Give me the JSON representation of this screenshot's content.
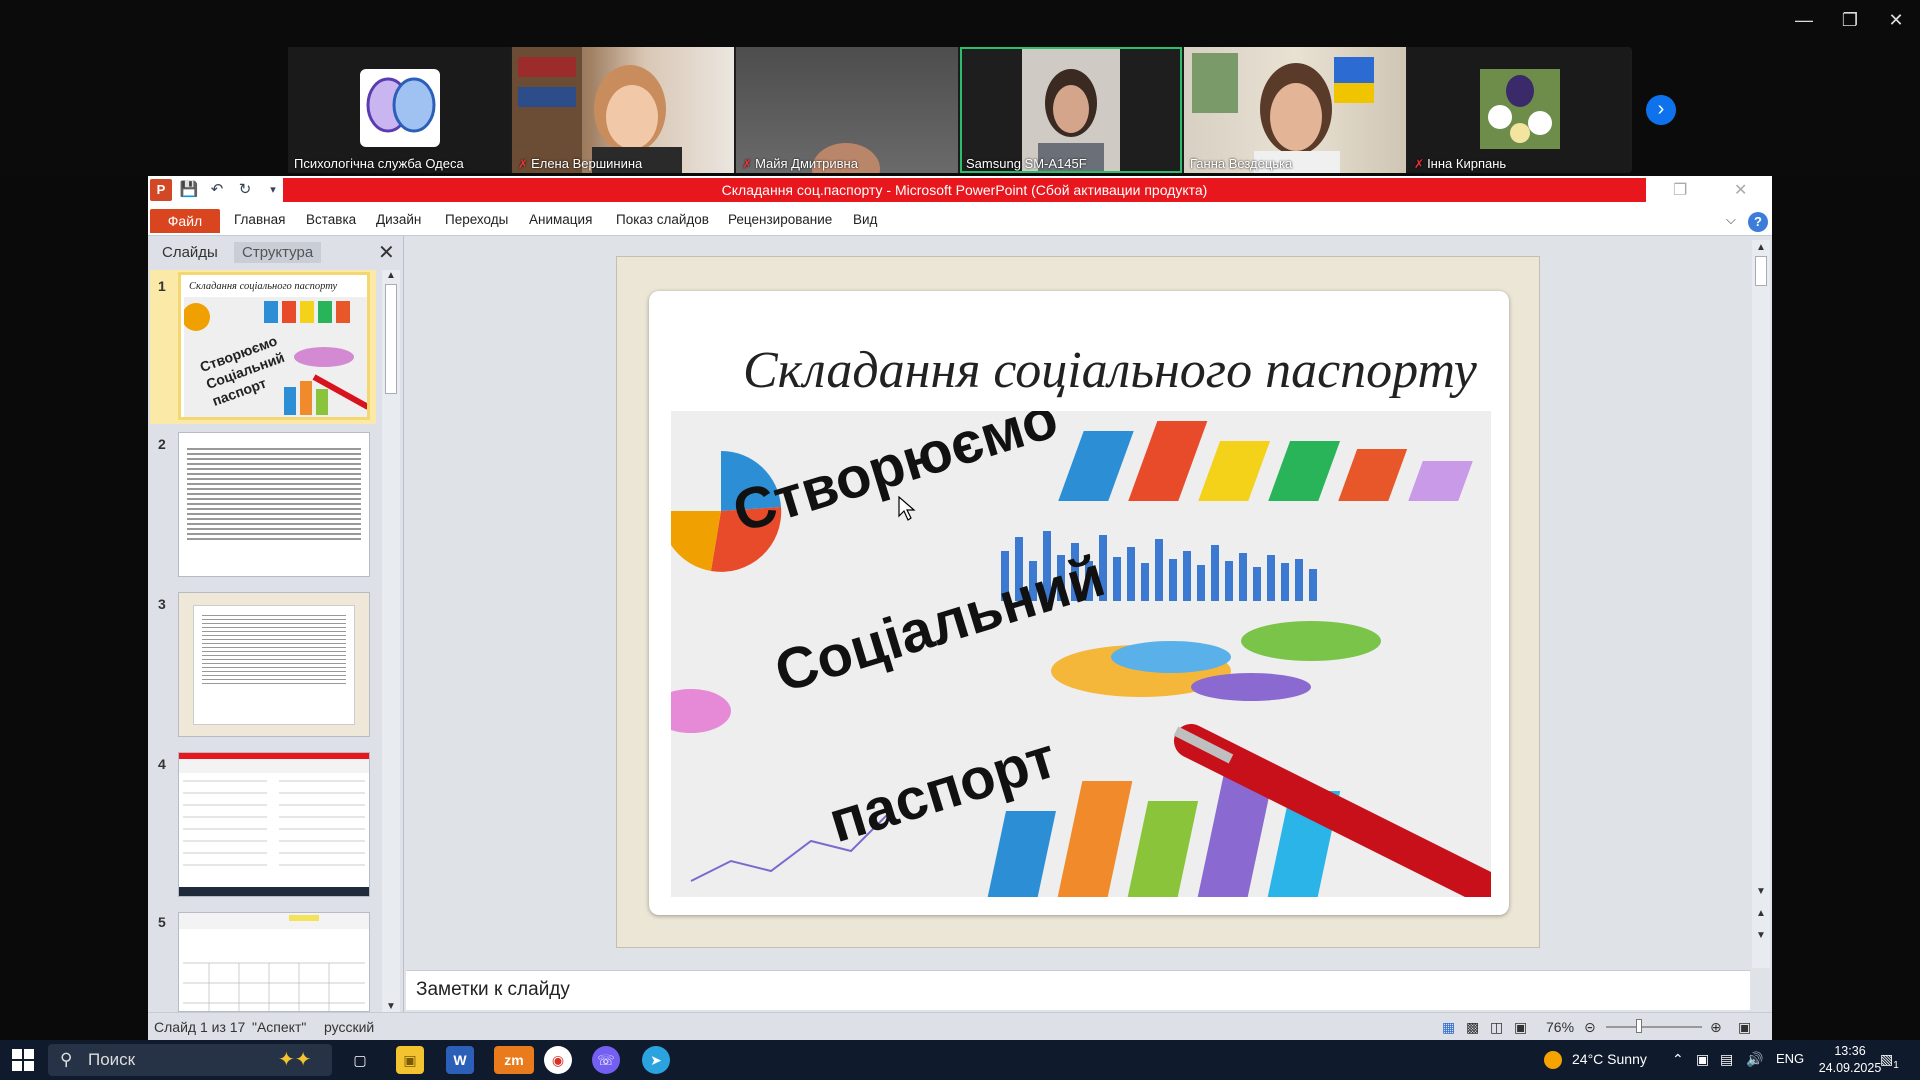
{
  "zoom": {
    "participants": [
      {
        "name": "Психологічна служба Одеса",
        "muted": false,
        "active": false
      },
      {
        "name": "Елена Вершинина",
        "muted": true,
        "active": false
      },
      {
        "name": "Майя Дмитривна",
        "muted": true,
        "active": false
      },
      {
        "name": "Samsung SM-A145F",
        "muted": false,
        "active": true
      },
      {
        "name": "Ганна Вездецька",
        "muted": false,
        "active": false
      },
      {
        "name": "Інна Кирпань",
        "muted": true,
        "active": false
      }
    ],
    "next_icon": "chevron-right-icon"
  },
  "ppt": {
    "window_title": "Складання соц.паспорту - Microsoft PowerPoint (Сбой активации продукта)",
    "file_tab": "Файл",
    "tabs": [
      "Главная",
      "Вставка",
      "Дизайн",
      "Переходы",
      "Анимация",
      "Показ слайдов",
      "Рецензирование",
      "Вид"
    ],
    "pane_tabs": {
      "slides": "Слайды",
      "outline": "Структура"
    },
    "thumbnails": [
      {
        "num": "1",
        "title": "Складання соціального паспорту",
        "text": "Створюємо Соціальний паспорт"
      },
      {
        "num": "2"
      },
      {
        "num": "3"
      },
      {
        "num": "4"
      },
      {
        "num": "5"
      }
    ],
    "slide": {
      "title": "Складання соціального паспорту",
      "image_text_1": "Створюємо",
      "image_text_2": "Соціальний",
      "image_text_3": "паспорт"
    },
    "notes_placeholder": "Заметки к слайду",
    "status": {
      "slide_info": "Слайд 1 из 17",
      "theme": "\"Аспект\"",
      "language": "русский",
      "zoom": "76%"
    }
  },
  "taskbar": {
    "search_label": "Поиск",
    "weather": "24°C  Sunny",
    "lang": "ENG",
    "time": "13:36",
    "date": "24.09.2025",
    "notif_count": "1"
  }
}
